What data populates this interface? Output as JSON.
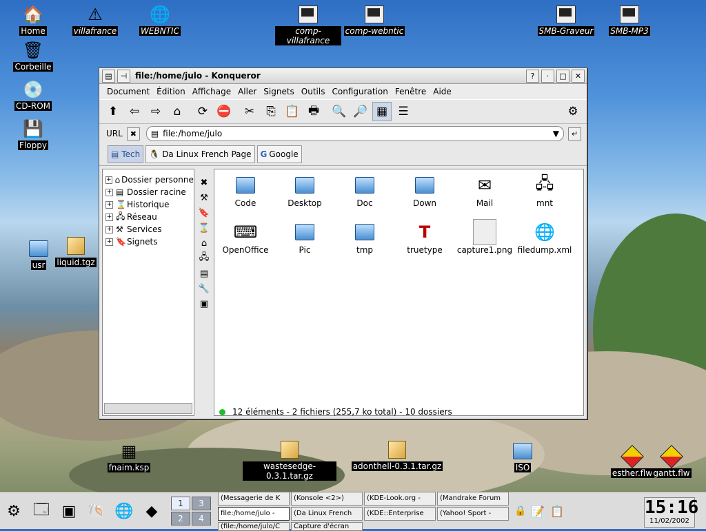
{
  "desktop_icons": [
    {
      "label": "Home",
      "icon": "home-icon"
    },
    {
      "label": "villafrance",
      "icon": "warning-icon",
      "italic": true
    },
    {
      "label": "WEBNTIC",
      "icon": "globe-icon",
      "italic": true
    },
    {
      "label": "comp-villafrance",
      "icon": "terminal-icon",
      "italic": true
    },
    {
      "label": "comp-webntic",
      "icon": "terminal-icon",
      "italic": true
    },
    {
      "label": "SMB-Graveur",
      "icon": "terminal-icon",
      "italic": true
    },
    {
      "label": "SMB-MP3",
      "icon": "terminal-icon",
      "italic": true
    },
    {
      "label": "Corbeille",
      "icon": "trash-icon"
    },
    {
      "label": "CD-ROM",
      "icon": "cdrom-icon"
    },
    {
      "label": "Floppy",
      "icon": "floppy-icon"
    },
    {
      "label": "usr",
      "icon": "folder-icon"
    },
    {
      "label": "liquid.tgz",
      "icon": "package-icon"
    },
    {
      "label": "fnaim.ksp",
      "icon": "grid-icon"
    },
    {
      "label": "wastesedge-0.3.1.tar.gz",
      "icon": "package-icon"
    },
    {
      "label": "adonthell-0.3.1.tar.gz",
      "icon": "package-icon"
    },
    {
      "label": "ISO",
      "icon": "folder-icon"
    },
    {
      "label": "esther.flw",
      "icon": "diamond-icon"
    },
    {
      "label": "gantt.flw",
      "icon": "diamond-icon"
    }
  ],
  "window": {
    "title": "file:/home/julo - Konqueror",
    "menu": [
      "Document",
      "Édition",
      "Affichage",
      "Aller",
      "Signets",
      "Outils",
      "Configuration",
      "Fenêtre",
      "Aide"
    ],
    "url_label": "URL",
    "url": "file:/home/julo",
    "bookmarks": [
      "Tech",
      "Da Linux French Page",
      "Google"
    ],
    "tree": [
      {
        "label": "Dossier personnel"
      },
      {
        "label": "Dossier racine"
      },
      {
        "label": "Historique"
      },
      {
        "label": "Réseau"
      },
      {
        "label": "Services"
      },
      {
        "label": "Signets"
      }
    ],
    "files": [
      {
        "name": "Code",
        "icon": "folder-icon"
      },
      {
        "name": "Desktop",
        "icon": "folder-icon"
      },
      {
        "name": "Doc",
        "icon": "folder-icon"
      },
      {
        "name": "Down",
        "icon": "folder-icon"
      },
      {
        "name": "Mail",
        "icon": "mail-icon"
      },
      {
        "name": "mnt",
        "icon": "network-icon"
      },
      {
        "name": "OpenOffice",
        "icon": "typewriter-icon"
      },
      {
        "name": "Pic",
        "icon": "folder-icon"
      },
      {
        "name": "tmp",
        "icon": "folder-icon"
      },
      {
        "name": "truetype",
        "icon": "font-icon"
      },
      {
        "name": "capture1.png",
        "icon": "image-icon"
      },
      {
        "name": "filedump.xml",
        "icon": "document-icon"
      }
    ],
    "status": "12 éléments - 2 fichiers (255,7 ko total) - 10 dossiers"
  },
  "taskbar": {
    "pager": [
      "1",
      "3",
      "2",
      "4"
    ],
    "tasks": [
      "(Messagerie de K",
      "(Konsole <2>)",
      "(KDE-Look.org -",
      "(Mandrake Forum",
      "file:/home/julo -",
      "(Da Linux French",
      "(KDE::Enterprise",
      "(Yahoo! Sport -",
      "(file:/home/julo/C",
      "Capture d'écran"
    ],
    "time": "15:16",
    "date": "11/02/2002"
  }
}
